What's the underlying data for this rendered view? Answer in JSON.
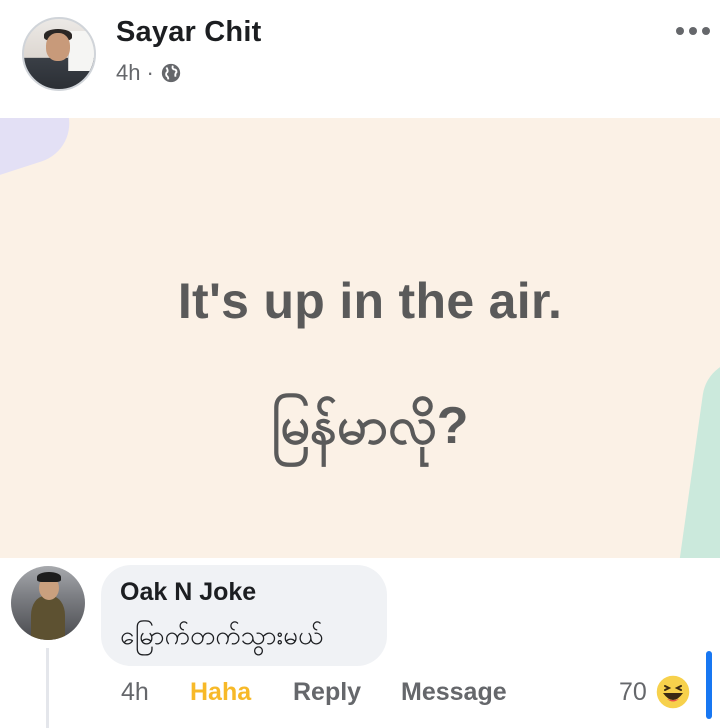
{
  "post": {
    "author": "Sayar Chit",
    "time": "4h",
    "separator": "·",
    "privacy_icon": "globe-icon",
    "more_icon": "more-options-icon",
    "background_color": "#fbf1e6",
    "text_en": "It's up in the air.",
    "text_my": "မြန်မာလို?"
  },
  "comment": {
    "author": "Oak N Joke",
    "text": "မြောက်တက်သွားမယ်",
    "time": "4h",
    "reaction_label": "Haha",
    "reply_label": "Reply",
    "message_label": "Message",
    "reaction_count": "70",
    "reaction_icon": "haha-emoji-icon"
  },
  "colors": {
    "haha": "#f7b928",
    "muted": "#65676b",
    "text": "#1c1e21",
    "accent": "#1877f2"
  }
}
